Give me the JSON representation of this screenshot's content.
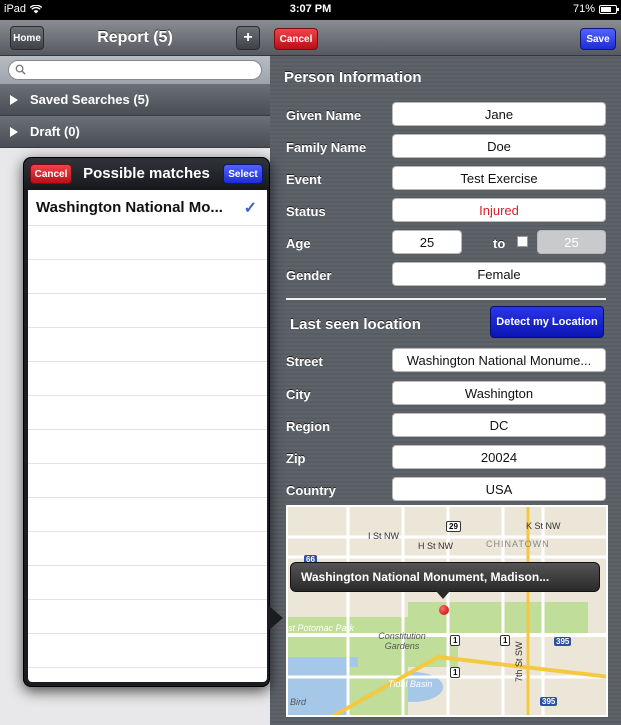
{
  "status_bar": {
    "device": "iPad",
    "time": "3:07 PM",
    "battery": "71%",
    "battery_level": 0.71
  },
  "master": {
    "home_label": "Home",
    "title": "Report (5)",
    "add_label": "+",
    "search_placeholder": "",
    "sections": [
      {
        "label": "Saved Searches (5)"
      },
      {
        "label": "Draft (0)"
      }
    ]
  },
  "detail": {
    "cancel_label": "Cancel",
    "save_label": "Save",
    "person_section_title": "Person Information",
    "labels": {
      "given_name": "Given Name",
      "family_name": "Family Name",
      "event": "Event",
      "status": "Status",
      "age": "Age",
      "age_to": "to",
      "gender": "Gender",
      "street": "Street",
      "city": "City",
      "region": "Region",
      "zip": "Zip",
      "country": "Country"
    },
    "values": {
      "given_name": "Jane",
      "family_name": "Doe",
      "event": "Test Exercise",
      "status": "Injured",
      "age_from": "25",
      "age_to": "25",
      "gender": "Female",
      "street": "Washington National Monume...",
      "city": "Washington",
      "region": "DC",
      "zip": "20024",
      "country": "USA"
    },
    "location_section_title": "Last seen location",
    "detect_label": "Detect my Location",
    "map": {
      "callout": "Washington National Monument, Madison...",
      "labels": {
        "i_st": "I St NW",
        "h_st": "H St NW",
        "k_st": "K St NW",
        "chinatown": "CHINATOWN",
        "potomac": "st Potomac Park",
        "constitution": "Constitution Gardens",
        "tidal": "Tidal Basin",
        "seventh": "7th St SW",
        "bird": "Bird",
        "route_29": "29",
        "route_66": "66",
        "route_395_a": "395",
        "route_395_b": "395",
        "route_1a": "1",
        "route_1b": "1",
        "route_1c": "1"
      }
    }
  },
  "popover": {
    "cancel_label": "Cancel",
    "title": "Possible matches",
    "select_label": "Select",
    "items": [
      {
        "label": "Washington National Mo...",
        "checked": "✓"
      }
    ]
  }
}
